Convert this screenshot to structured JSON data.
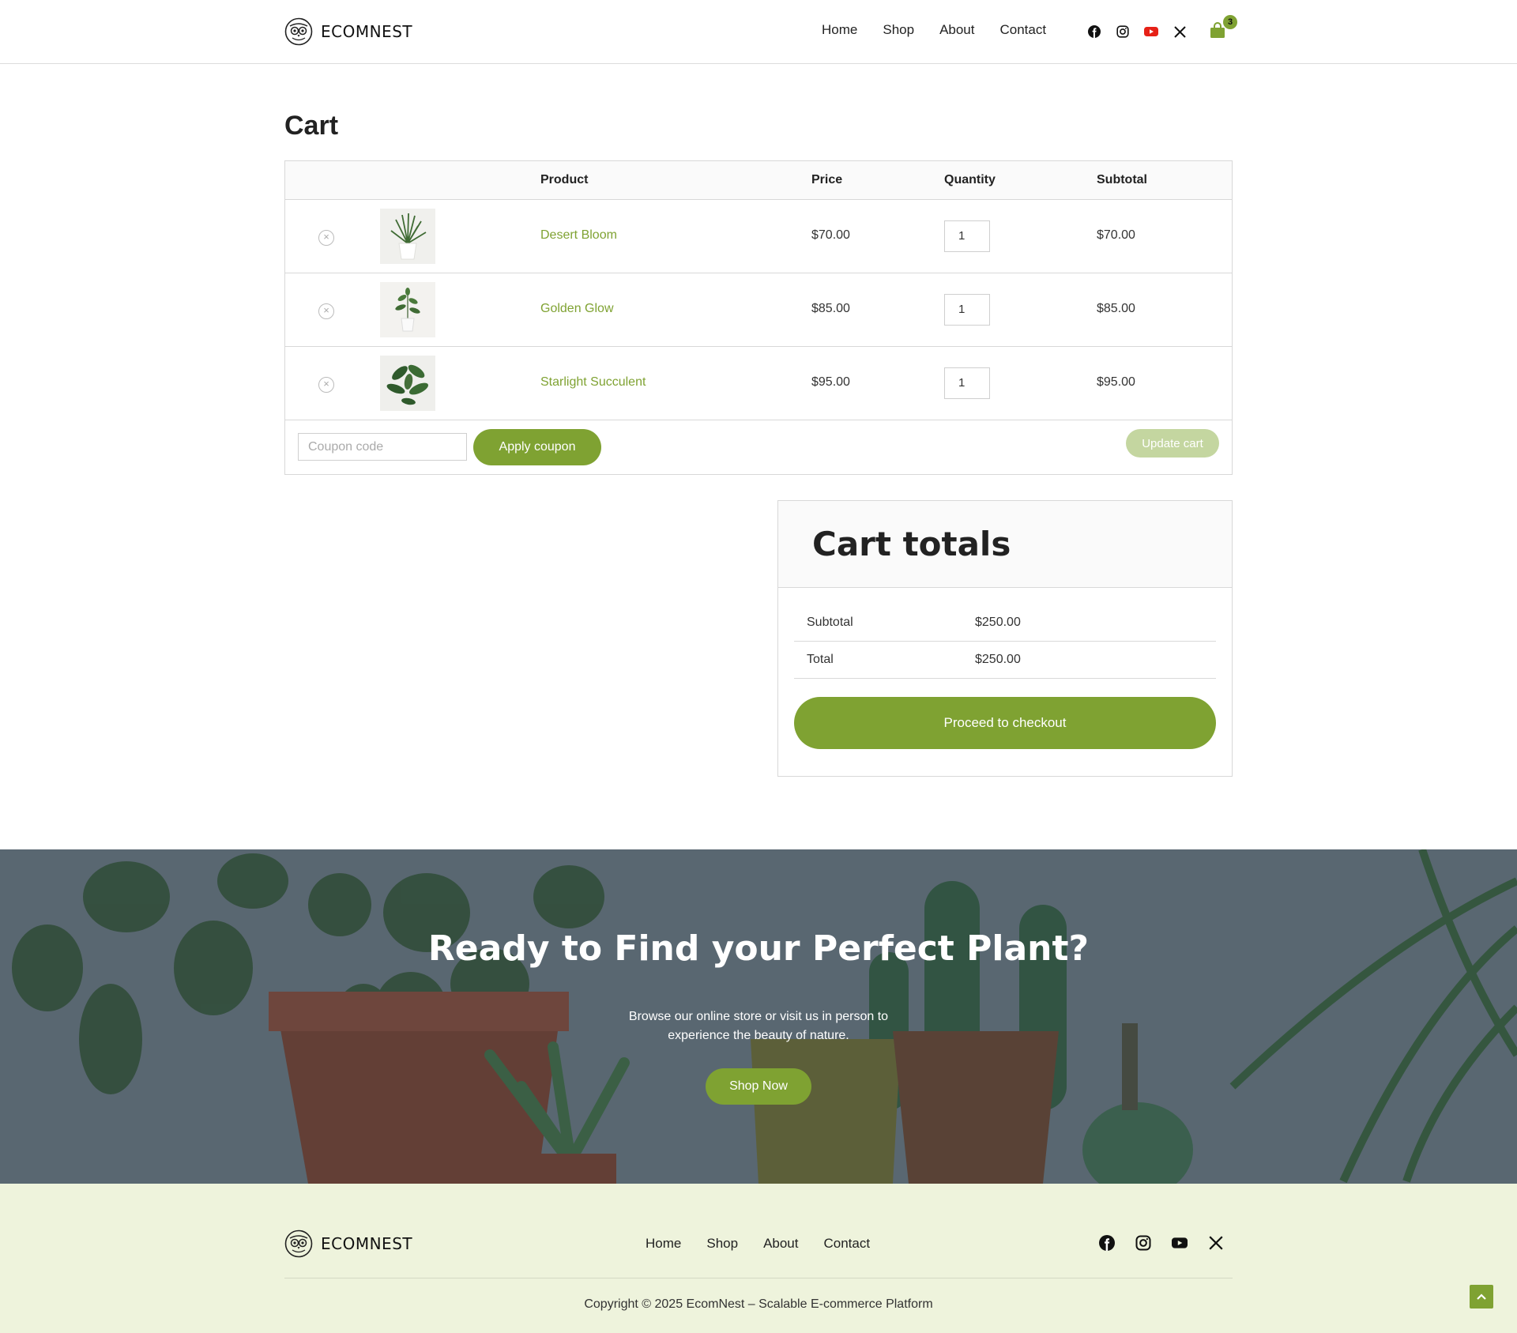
{
  "brand": {
    "name": "ECOMNEST",
    "icon": "owl-logo-icon"
  },
  "nav": {
    "items": [
      "Home",
      "Shop",
      "About",
      "Contact"
    ]
  },
  "socials": [
    "facebook-icon",
    "instagram-icon",
    "youtube-icon",
    "x-icon"
  ],
  "cart": {
    "count": "3",
    "icon": "shopping-bag-icon"
  },
  "page": {
    "title": "Cart"
  },
  "table": {
    "headers": {
      "product": "Product",
      "price": "Price",
      "quantity": "Quantity",
      "subtotal": "Subtotal"
    },
    "rows": [
      {
        "name": "Desert Bloom",
        "price": "$70.00",
        "qty": "1",
        "subtotal": "$70.00"
      },
      {
        "name": "Golden Glow",
        "price": "$85.00",
        "qty": "1",
        "subtotal": "$85.00"
      },
      {
        "name": "Starlight Succulent",
        "price": "$95.00",
        "qty": "1",
        "subtotal": "$95.00"
      }
    ],
    "coupon_placeholder": "Coupon code",
    "apply_label": "Apply coupon",
    "update_label": "Update cart"
  },
  "totals": {
    "title": "Cart totals",
    "subtotal_label": "Subtotal",
    "subtotal_value": "$250.00",
    "total_label": "Total",
    "total_value": "$250.00",
    "checkout_label": "Proceed to checkout"
  },
  "banner": {
    "title": "Ready to Find your Perfect Plant?",
    "text": "Browse our online store or visit us in person to experience the beauty of nature.",
    "button": "Shop Now"
  },
  "footer": {
    "brand": "ECOMNEST",
    "nav": [
      "Home",
      "Shop",
      "About",
      "Contact"
    ],
    "copyright": "Copyright © 2025 EcomNest – Scalable E-commerce Platform"
  },
  "colors": {
    "accent": "#7fa232",
    "accent_light": "#c4d6a0",
    "footer_bg": "#eef3dc",
    "youtube": "#e62117"
  }
}
